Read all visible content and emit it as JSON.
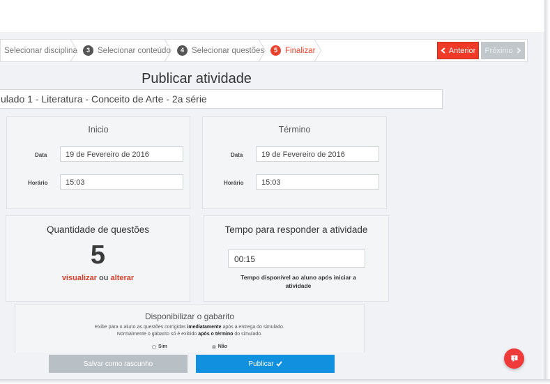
{
  "wizard": {
    "steps": [
      {
        "number": "",
        "label": "Selecionar disciplina"
      },
      {
        "number": "3",
        "label": "Selecionar conteúdo"
      },
      {
        "number": "4",
        "label": "Selecionar questões"
      },
      {
        "number": "5",
        "label": "Finalizar"
      }
    ],
    "prev_label": "Anterior",
    "next_label": "Próximo"
  },
  "page": {
    "title": "Publicar atividade",
    "activity_name": "ulado 1 - Literatura - Conceito de Arte - 2a série"
  },
  "inicio": {
    "title": "Inicio",
    "data_label": "Data",
    "data_value": "19 de Fevereiro de 2016",
    "horario_label": "Horário",
    "horario_value": "15:03"
  },
  "termino": {
    "title": "Término",
    "data_label": "Data",
    "data_value": "19 de Fevereiro de 2016",
    "horario_label": "Horário",
    "horario_value": "15:03"
  },
  "quantidade": {
    "title": "Quantidade de questões",
    "value": "5",
    "link_view": "visualizar",
    "connector": "ou",
    "link_change": "alterar"
  },
  "tempo": {
    "title": "Tempo para responder a atividade",
    "value": "00:15",
    "help_line1": "Tempo disponível ao aluno após iniciar a",
    "help_line2": "atividade"
  },
  "gabarito": {
    "title": "Disponibilizar o gabarito",
    "line1_pre": "Exibe para o aluno as questões corrigidas ",
    "line1_bold": "imediatamente",
    "line1_post": " após a entrega do simulado.",
    "line2_pre": "Normalmente o gabarito só é exibido ",
    "line2_bold": "após o término",
    "line2_post": " do simulado.",
    "option_yes": "Sim",
    "option_no": "Não",
    "selected": "Não"
  },
  "actions": {
    "draft_label": "Salvar como rascunho",
    "publish_label": "Publicar"
  },
  "colors": {
    "accent_red": "#ef3a28",
    "publish_blue": "#1290e0",
    "disabled_gray": "#c2c7cc"
  },
  "icons": [
    "chevron-left-icon",
    "chevron-right-icon",
    "check-icon",
    "help-chat-icon"
  ]
}
